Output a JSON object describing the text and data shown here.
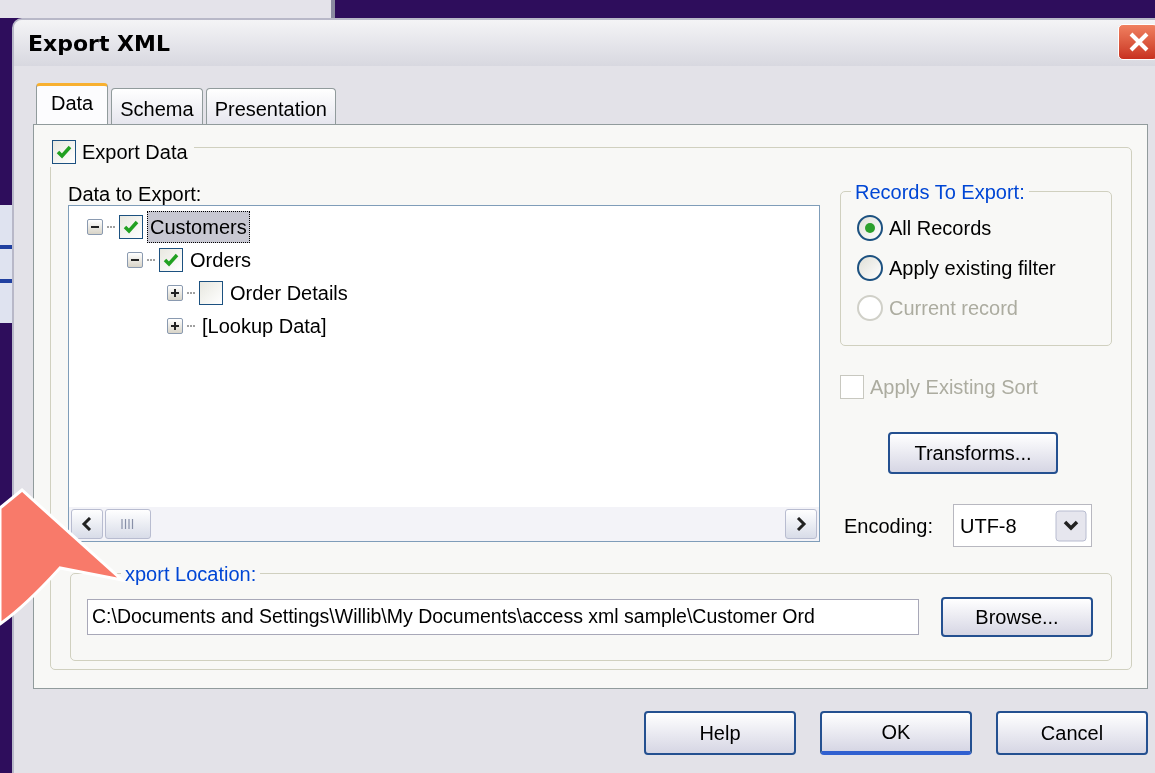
{
  "window": {
    "title": "Export XML"
  },
  "tabs": [
    {
      "label": "Data",
      "selected": true
    },
    {
      "label": "Schema",
      "selected": false
    },
    {
      "label": "Presentation",
      "selected": false
    }
  ],
  "export_data": {
    "label": "Export Data",
    "checked": true
  },
  "tree": {
    "label": "Data to Export:",
    "items": [
      {
        "label": "Customers",
        "checked": true,
        "expanded": true,
        "selected": true,
        "children": [
          {
            "label": "Orders",
            "checked": true,
            "expanded": true,
            "selected": false,
            "children": [
              {
                "label": "Order Details",
                "checked": false,
                "expanded": false,
                "selected": false
              },
              {
                "label": "[Lookup Data]",
                "expanded": false,
                "selected": false
              }
            ]
          }
        ]
      }
    ]
  },
  "records": {
    "label": "Records To Export:",
    "options": [
      {
        "label": "All Records",
        "selected": true,
        "disabled": false
      },
      {
        "label": "Apply existing filter",
        "selected": false,
        "disabled": false
      },
      {
        "label": "Current record",
        "selected": false,
        "disabled": true
      }
    ]
  },
  "apply_sort": {
    "label": "Apply Existing Sort",
    "checked": false,
    "disabled": true
  },
  "transforms_button": "Transforms...",
  "encoding": {
    "label": "Encoding:",
    "value": "UTF-8"
  },
  "export_location": {
    "label": "xport Location:",
    "value": "C:\\Documents and Settings\\Willib\\My Documents\\access xml sample\\Customer Ord"
  },
  "browse_button": "Browse...",
  "buttons": [
    {
      "label": "Help",
      "default": false
    },
    {
      "label": "OK",
      "default": true
    },
    {
      "label": "Cancel",
      "default": false
    }
  ]
}
